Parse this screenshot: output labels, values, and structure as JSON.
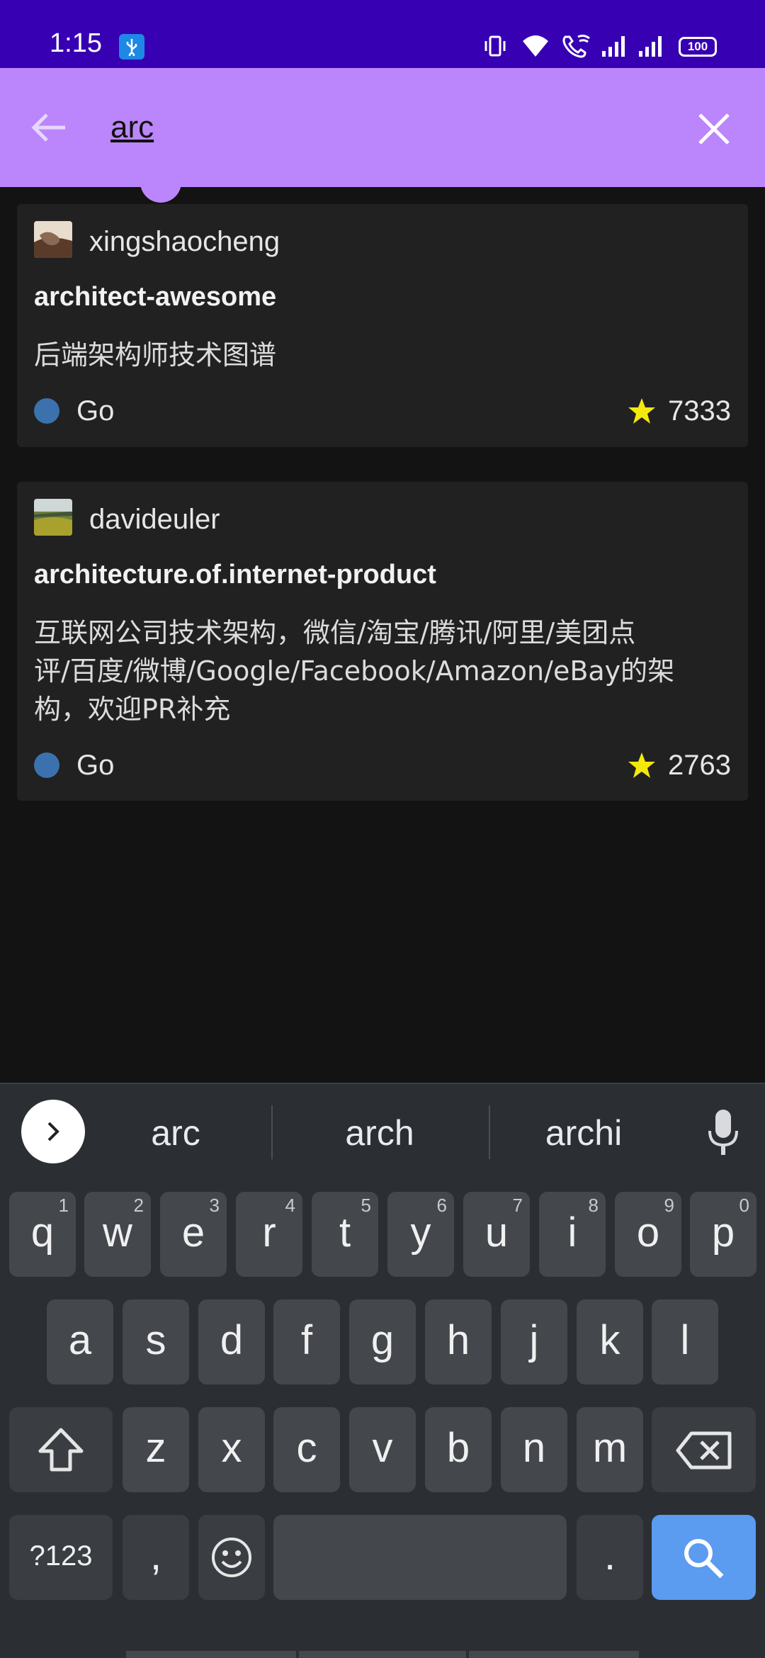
{
  "status_bar": {
    "time": "1:15",
    "battery": "100"
  },
  "search": {
    "query": "arc"
  },
  "results": [
    {
      "owner": "xingshaocheng",
      "repo": "architect-awesome",
      "description_lines": [
        "后端架构师技术图谱"
      ],
      "language": "Go",
      "language_color": "#3b72ad",
      "stars": "7333"
    },
    {
      "owner": "davideuler",
      "repo": "architecture.of.internet-product",
      "description_lines": [
        "互联网公司技术架构，微信/淘宝/腾讯/阿里/美团点",
        "评/百度/微博/Google/Facebook/Amazon/eBay的架",
        "构，欢迎PR补充"
      ],
      "language": "Go",
      "language_color": "#3b72ad",
      "stars": "2763"
    }
  ],
  "keyboard": {
    "suggestions": [
      "arc",
      "arch",
      "archi"
    ],
    "row1": [
      {
        "key": "q",
        "num": "1"
      },
      {
        "key": "w",
        "num": "2"
      },
      {
        "key": "e",
        "num": "3"
      },
      {
        "key": "r",
        "num": "4"
      },
      {
        "key": "t",
        "num": "5"
      },
      {
        "key": "y",
        "num": "6"
      },
      {
        "key": "u",
        "num": "7"
      },
      {
        "key": "i",
        "num": "8"
      },
      {
        "key": "o",
        "num": "9"
      },
      {
        "key": "p",
        "num": "0"
      }
    ],
    "row2": [
      "a",
      "s",
      "d",
      "f",
      "g",
      "h",
      "j",
      "k",
      "l"
    ],
    "row3": [
      "z",
      "x",
      "c",
      "v",
      "b",
      "n",
      "m"
    ],
    "symbols_label": "?123",
    "comma_label": ",",
    "period_label": "."
  }
}
